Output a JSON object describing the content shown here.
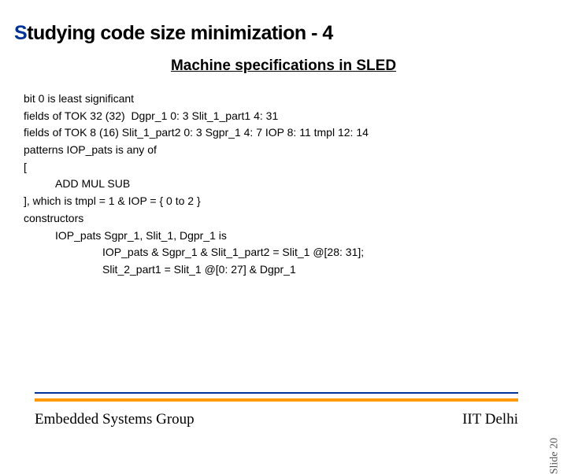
{
  "title_prefix": "S",
  "title_rest": "tudying code size minimization - 4",
  "subtitle": "Machine specifications in SLED",
  "lines": {
    "l1": "bit 0 is least significant",
    "l2": "fields of TOK 32 (32)  Dgpr_1 0: 3 Slit_1_part1 4: 31",
    "l3": "fields of TOK 8 (16) Slit_1_part2 0: 3 Sgpr_1 4: 7 IOP 8: 11 tmpl 12: 14",
    "l4": "patterns IOP_pats is any of",
    "l5": "[",
    "l6": "ADD MUL SUB",
    "l7": "], which is tmpl = 1 & IOP = { 0 to 2 }",
    "l8": "constructors",
    "l9": "IOP_pats Sgpr_1, Slit_1, Dgpr_1 is",
    "l10": "IOP_pats & Sgpr_1 & Slit_1_part2 = Slit_1 @[28: 31];",
    "l11": "Slit_2_part1 = Slit_1 @[0: 27] & Dgpr_1"
  },
  "footer": {
    "left": "Embedded Systems Group",
    "right": "IIT Delhi"
  },
  "slide_number": "Slide 20"
}
